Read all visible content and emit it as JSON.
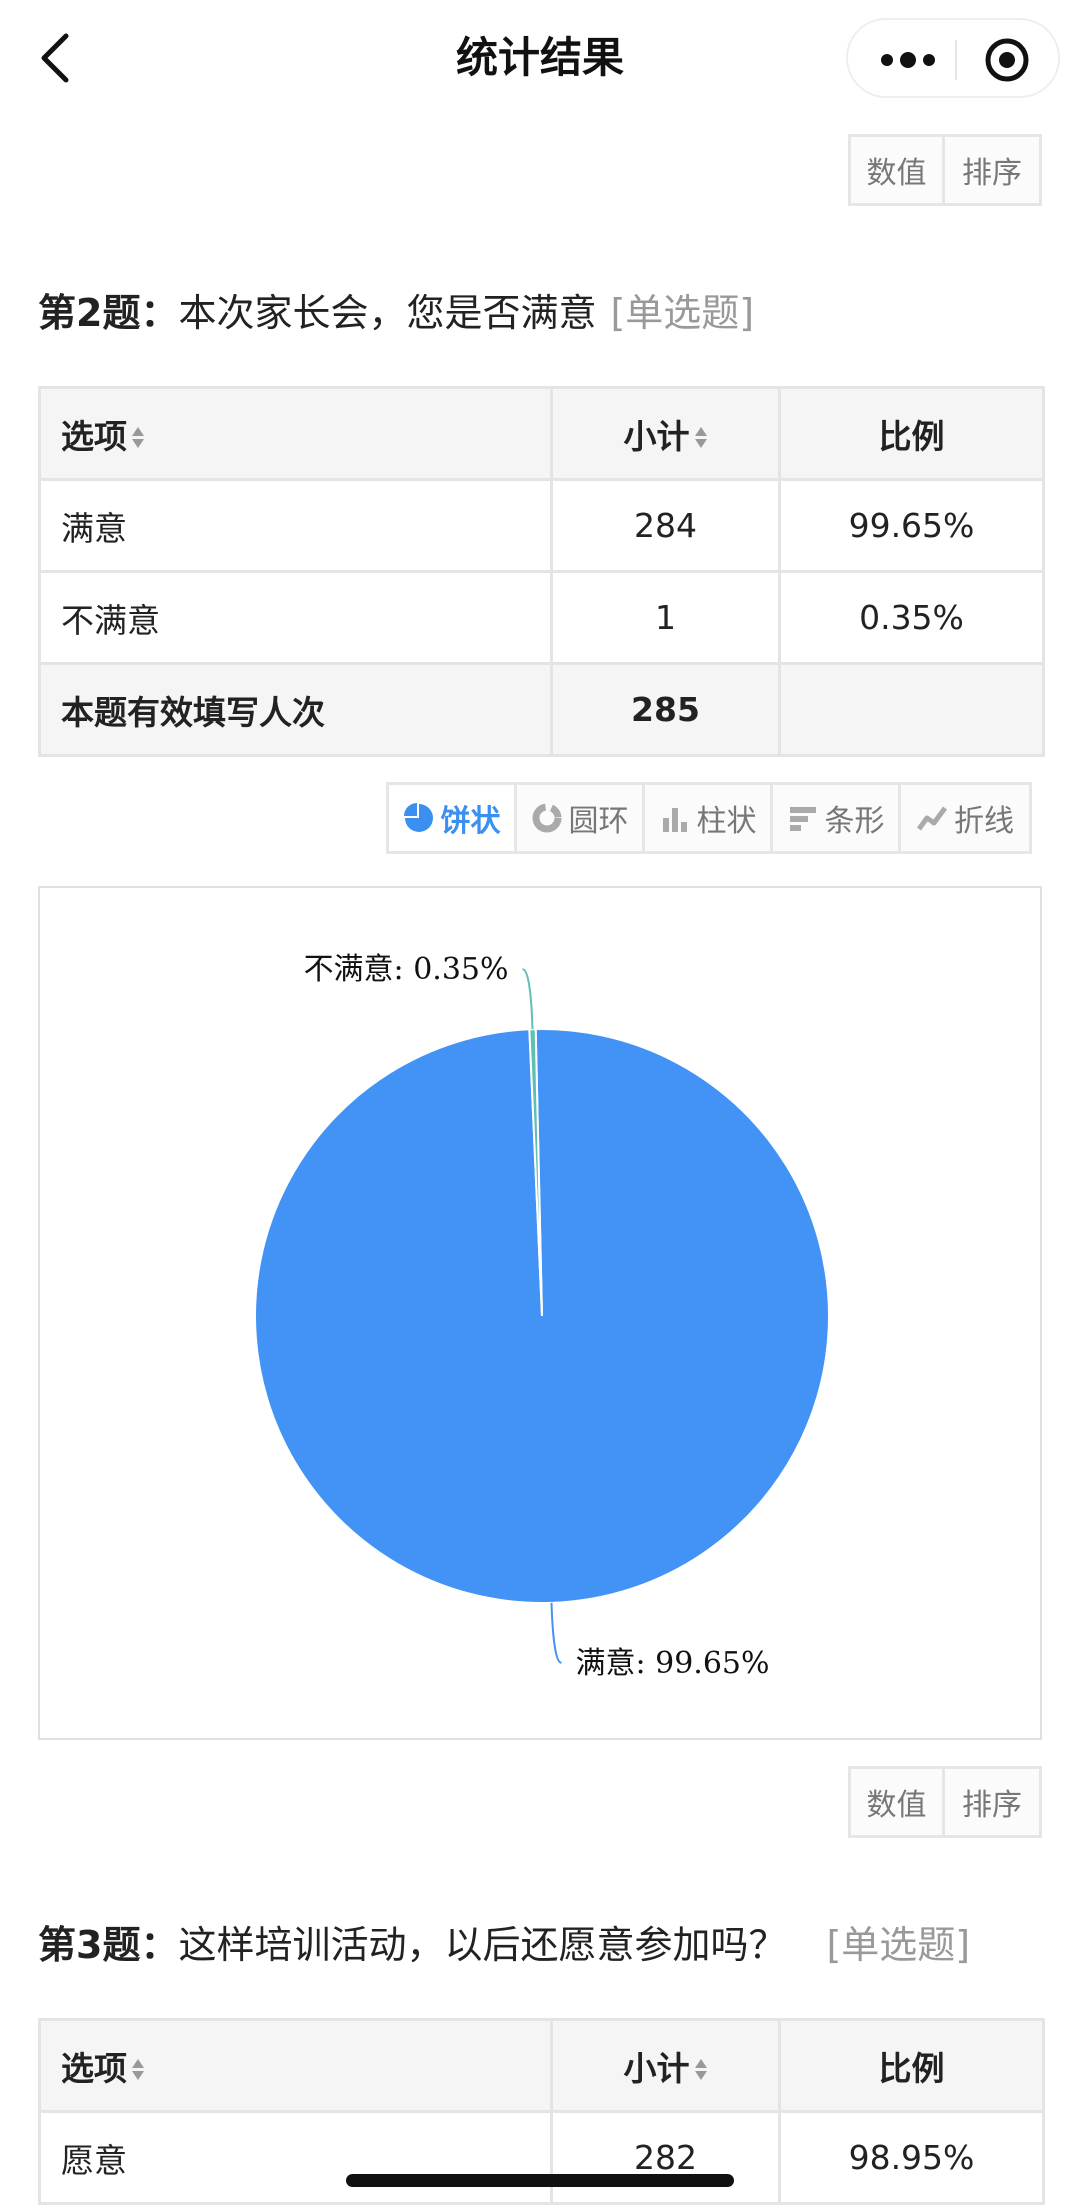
{
  "nav": {
    "title": "统计结果"
  },
  "value_sort": {
    "value_label": "数值",
    "sort_label": "排序"
  },
  "q2": {
    "number": "第2题：",
    "text": "本次家长会，您是否满意",
    "type": "[单选题]",
    "headers": {
      "option": "选项",
      "count": "小计",
      "ratio": "比例"
    },
    "rows": [
      {
        "option": "满意",
        "count": "284",
        "ratio": "99.65%"
      },
      {
        "option": "不满意",
        "count": "1",
        "ratio": "0.35%"
      }
    ],
    "total": {
      "label": "本题有效填写人次",
      "count": "285"
    }
  },
  "chart_types": [
    "饼状",
    "圆环",
    "柱状",
    "条形",
    "折线"
  ],
  "chart_data": {
    "type": "pie",
    "slices": [
      {
        "name": "满意",
        "value": 284,
        "percent": 99.65,
        "color": "#4293f5",
        "label": "满意: 99.65%"
      },
      {
        "name": "不满意",
        "value": 1,
        "percent": 0.35,
        "color": "#5fbfb6",
        "label": "不满意: 0.35%"
      }
    ]
  },
  "q3": {
    "number": "第3题：",
    "text": "这样培训活动，以后还愿意参加吗？",
    "type": "[单选题]",
    "headers": {
      "option": "选项",
      "count": "小计",
      "ratio": "比例"
    },
    "rows": [
      {
        "option": "愿意",
        "count": "282",
        "ratio": "98.95%"
      }
    ]
  }
}
